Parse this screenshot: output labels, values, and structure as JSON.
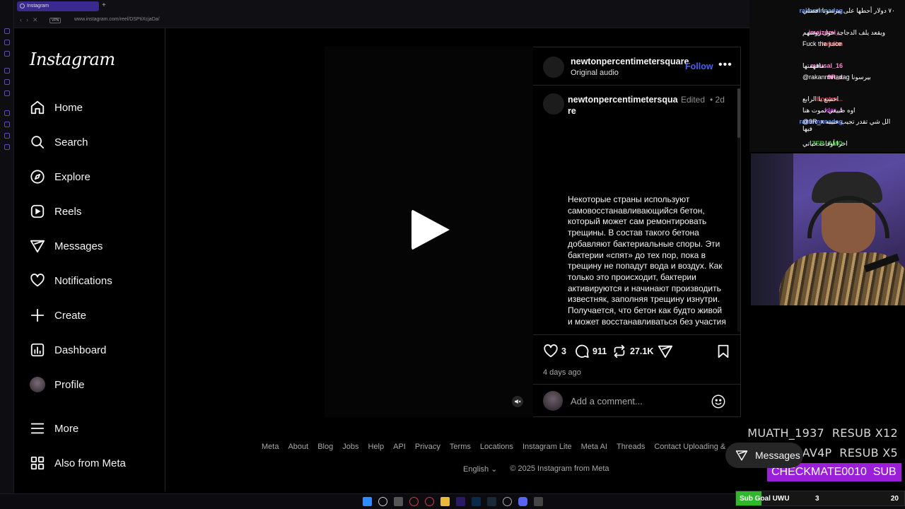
{
  "browser": {
    "tab_title": "Instagram",
    "url": "www.instagram.com/reel/DSPtiXcjaDa/",
    "vpn_badge": "VPN"
  },
  "sidebar": {
    "logo": "Instagram",
    "items": [
      {
        "label": "Home",
        "icon": "home-icon"
      },
      {
        "label": "Search",
        "icon": "search-icon"
      },
      {
        "label": "Explore",
        "icon": "compass-icon"
      },
      {
        "label": "Reels",
        "icon": "reels-icon"
      },
      {
        "label": "Messages",
        "icon": "messages-icon"
      },
      {
        "label": "Notifications",
        "icon": "heart-icon"
      },
      {
        "label": "Create",
        "icon": "plus-icon"
      },
      {
        "label": "Dashboard",
        "icon": "dashboard-icon"
      },
      {
        "label": "Profile",
        "icon": "avatar"
      }
    ],
    "more": "More",
    "also_from_meta": "Also from Meta"
  },
  "post": {
    "username": "newtonpercentimetersquare",
    "audio": "Original audio",
    "follow": "Follow",
    "more": "•••",
    "caption_username": "newtonpercentimetersquare",
    "edited": "Edited",
    "time_sep": "•",
    "time_ago": "2d",
    "caption": "Некоторые страны используют самовосстанавливающийся бетон, который может сам ремонтировать трещины. В состав такого бетона добавляют бактериальные споры. Эти бактерии «спят» до тех пор, пока в трещину не попадут вода и воздух. Как только это происходит, бактерии активируются и начинают производить известняк, заполняя трещину изнутри. Получается, что бетон как будто живой и может восстанавливаться без участия",
    "likes": "3",
    "comments": "911",
    "reposts": "27.1K",
    "date": "4 days ago",
    "comment_placeholder": "Add a comment..."
  },
  "footer": {
    "links": [
      "Meta",
      "About",
      "Blog",
      "Jobs",
      "Help",
      "API",
      "Privacy",
      "Terms",
      "Locations",
      "Instagram Lite",
      "Meta AI",
      "Threads",
      "Contact Uploading & Non-Users"
    ],
    "language": "English",
    "copyright": "© 2025 Instagram from Meta"
  },
  "floating_messages": "Messages",
  "stream": {
    "chat": [
      {
        "user": "rakannnnadag",
        "color": "#5b8cff",
        "msg": "٧٠ دولار أحطها على بيرسونا افضلي"
      },
      {
        "user": "imaizumi__",
        "color": "#ff7fd5",
        "msg": "ويقعد يلف الدجاجة حول روسهم"
      },
      {
        "user": "iwssim",
        "color": "#ff4b4b",
        "msg": "Fuck the juice"
      },
      {
        "user": "mausal_16",
        "color": "#ff7fd5",
        "msg": "ماقهمتها"
      },
      {
        "user": "9R_x",
        "color": "#ff7fd5",
        "msg": "@rakannnnadag بيرسونا"
      },
      {
        "user": "bogym...",
        "color": "#c43a3a",
        "msg": "اخشع يا الرابع"
      },
      {
        "user": "klar_z",
        "color": "#c44ad6",
        "msg": "اوه طبيعي تموت هنا"
      },
      {
        "user": "rakannnnadag",
        "color": "#5b8cff",
        "msg": "@9R_x الل شي تقدر تجيب حبيبه فيها"
      },
      {
        "user": "ZER_AMO",
        "color": "#3cc43c",
        "msg": "اخرا أوقات حياتي"
      }
    ],
    "alerts": [
      {
        "name": "MUATH_1937",
        "text": "RESUB X12"
      },
      {
        "name": "AV4P",
        "text": "RESUB X5"
      }
    ],
    "sub_alert": {
      "name": "CHECKMATE0010",
      "text": "SUB"
    },
    "sub_goal": {
      "label": "Sub Goal UWU",
      "current": "3",
      "target": "20",
      "progress_fraction": 0.15
    }
  }
}
